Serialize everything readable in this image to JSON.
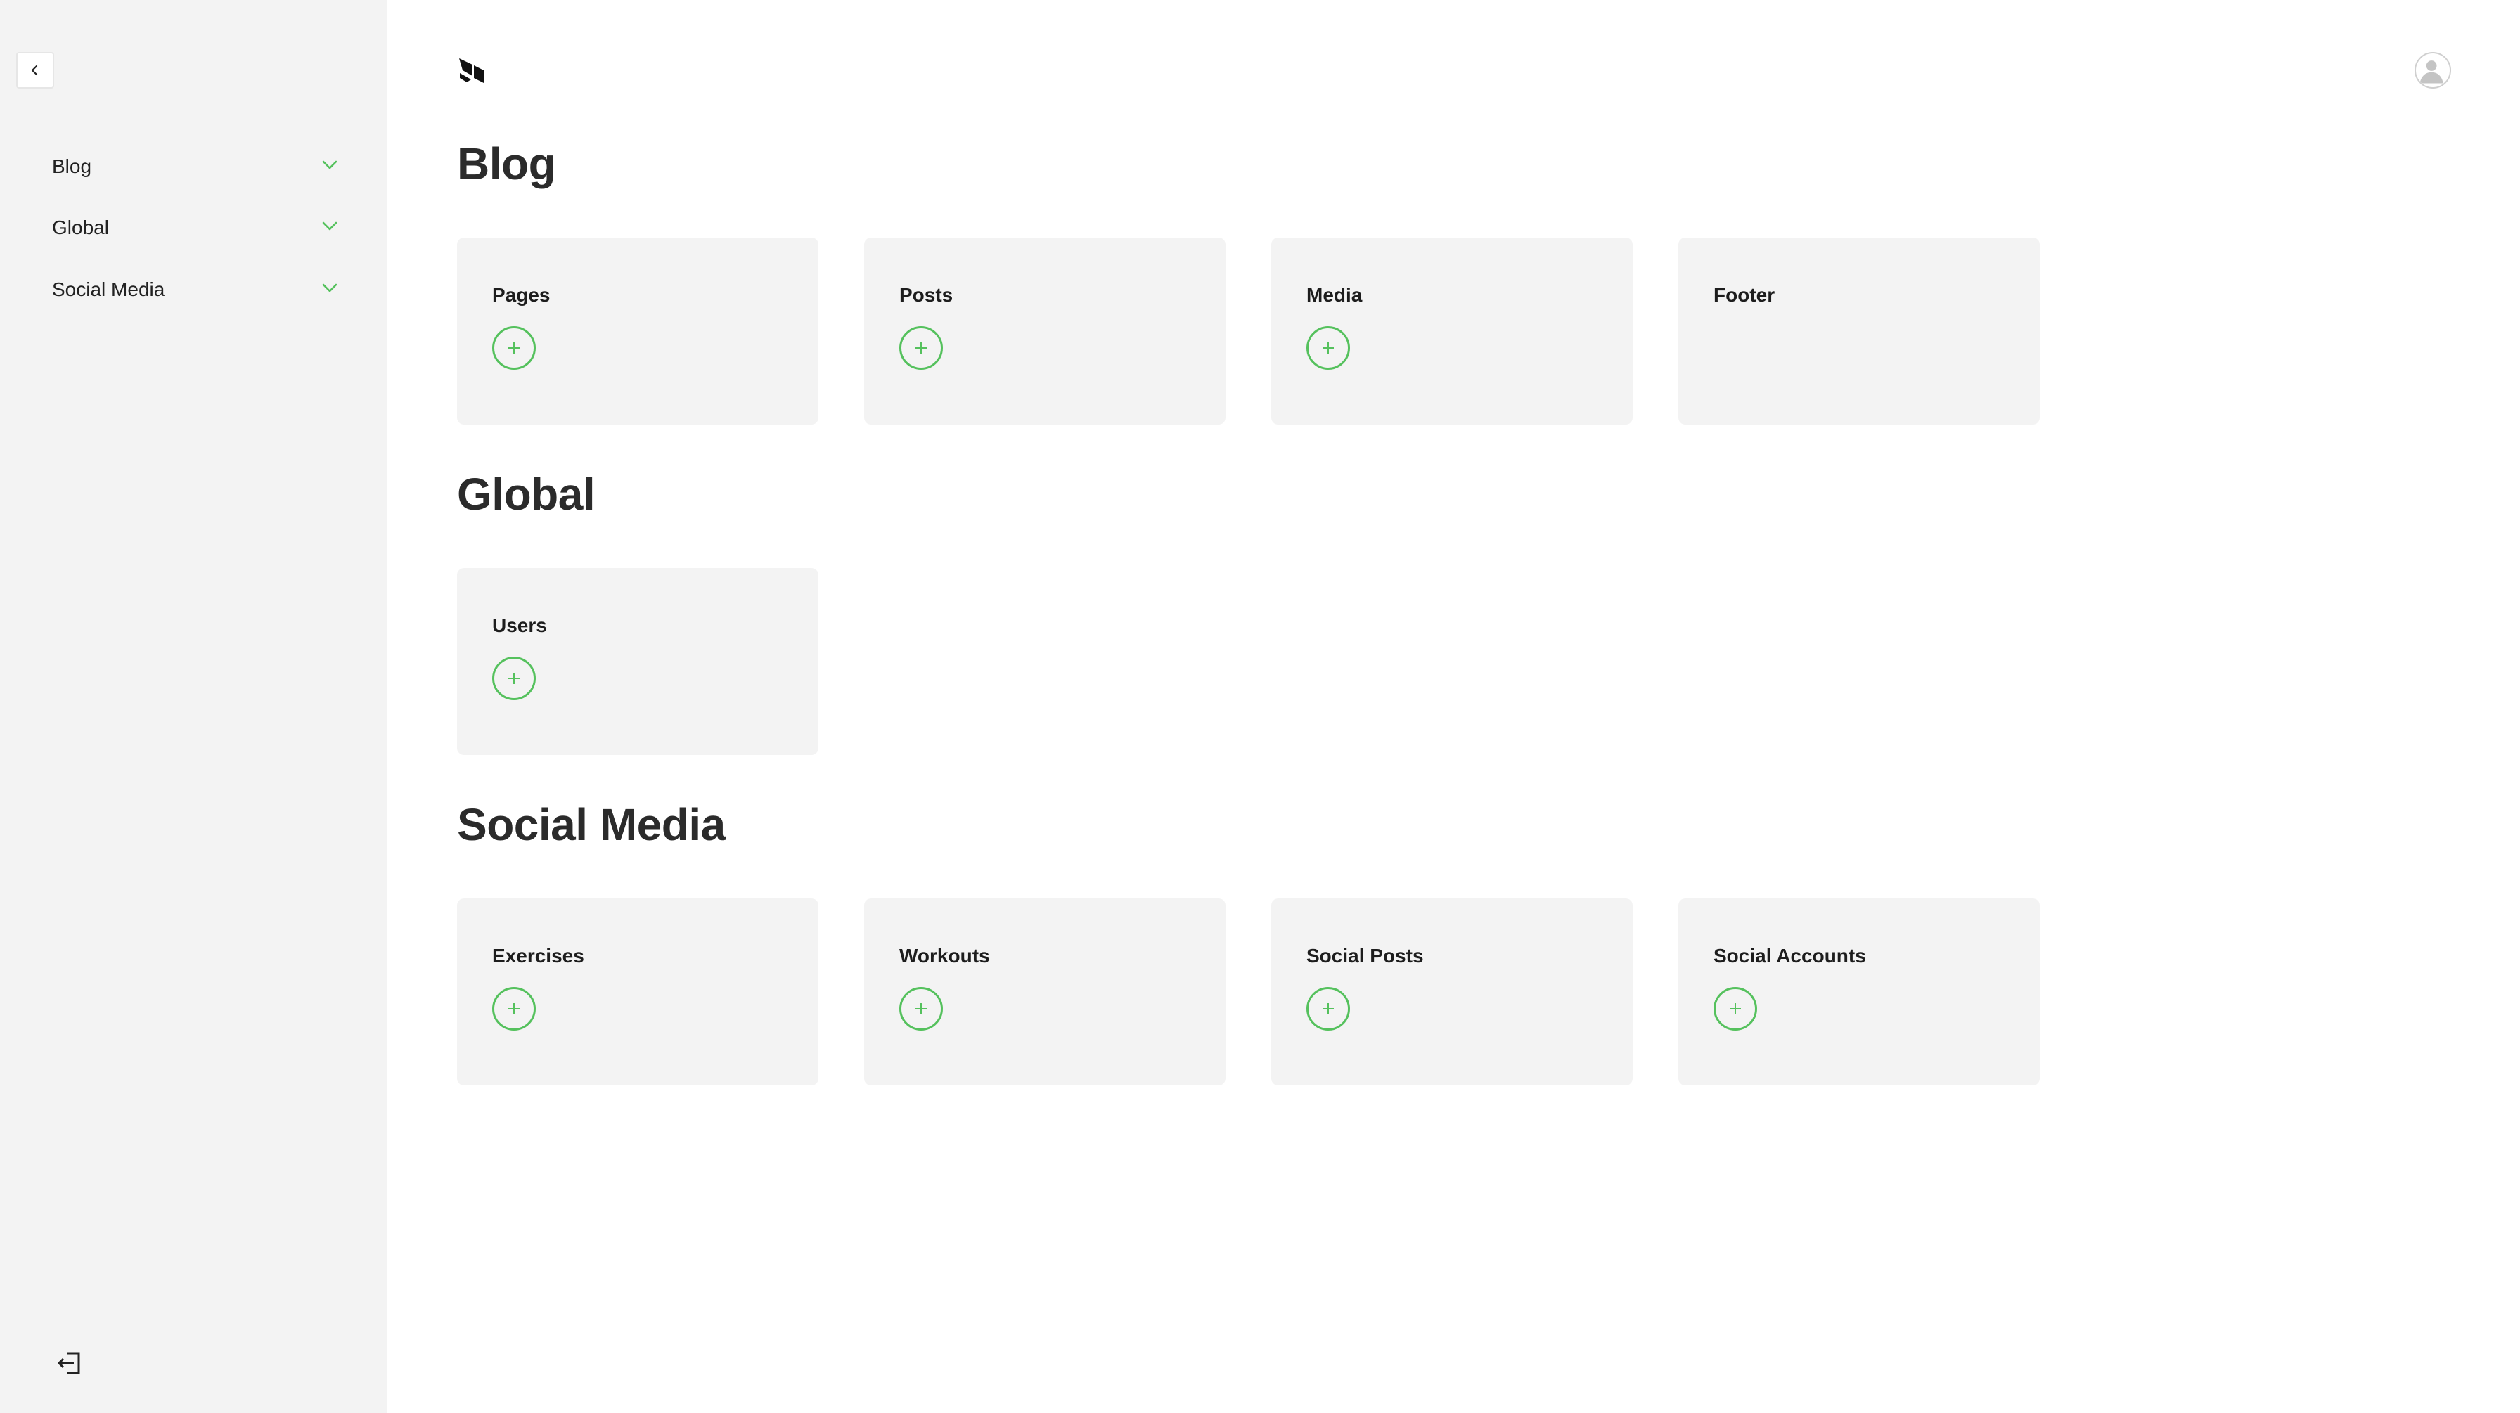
{
  "sidebar": {
    "collapse_icon": "chevron-left-icon",
    "items": [
      {
        "label": "Blog",
        "icon": "chevron-down-icon"
      },
      {
        "label": "Global",
        "icon": "chevron-down-icon"
      },
      {
        "label": "Social Media",
        "icon": "chevron-down-icon"
      }
    ],
    "logout_icon": "logout-icon"
  },
  "header": {
    "logo_icon": "payload-logo-icon",
    "account_icon": "user-avatar-icon"
  },
  "sections": [
    {
      "title": "Blog",
      "cards": [
        {
          "label": "Pages",
          "has_add": true
        },
        {
          "label": "Posts",
          "has_add": true
        },
        {
          "label": "Media",
          "has_add": true
        },
        {
          "label": "Footer",
          "has_add": false
        }
      ]
    },
    {
      "title": "Global",
      "cards": [
        {
          "label": "Users",
          "has_add": true
        }
      ]
    },
    {
      "title": "Social Media",
      "cards": [
        {
          "label": "Exercises",
          "has_add": true
        },
        {
          "label": "Workouts",
          "has_add": true
        },
        {
          "label": "Social Posts",
          "has_add": true
        },
        {
          "label": "Social Accounts",
          "has_add": true
        }
      ]
    }
  ],
  "colors": {
    "accent": "#55c15d",
    "sidebar_bg": "#f3f3f3",
    "card_bg": "#f3f3f3",
    "text": "#222222"
  }
}
